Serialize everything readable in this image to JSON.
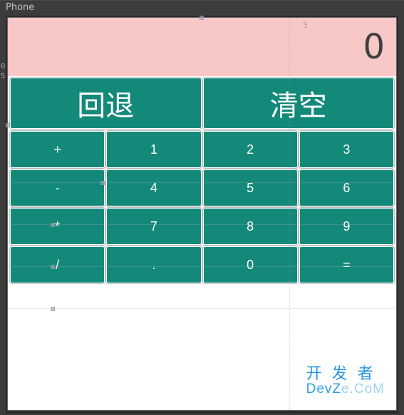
{
  "window": {
    "title": "Phone"
  },
  "display": {
    "value": "0",
    "ruler_mark": "5"
  },
  "ruler": {
    "left_top": "0",
    "left_bottom": "5"
  },
  "action_row": {
    "back": "回退",
    "clear": "清空"
  },
  "keypad": {
    "rows": [
      {
        "op": "+",
        "k1": "1",
        "k2": "2",
        "k3": "3"
      },
      {
        "op": "-",
        "k1": "4",
        "k2": "5",
        "k3": "6"
      },
      {
        "op": "*",
        "k1": "7",
        "k2": "8",
        "k3": "9"
      },
      {
        "op": "/",
        "k1": ".",
        "k2": "0",
        "k3": "="
      }
    ]
  },
  "watermark": {
    "line1": "开发者",
    "line2_a": "DevZ",
    "line2_b": "e.CoM"
  },
  "colors": {
    "button_bg": "#13897a",
    "display_bg": "#f7c8c6",
    "canvas_bg": "#3c3c3c",
    "watermark": "#2997e0"
  }
}
